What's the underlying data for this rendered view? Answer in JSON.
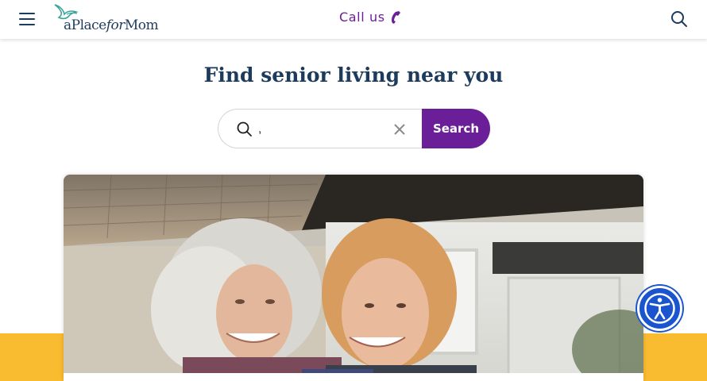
{
  "header": {
    "menu_icon": "hamburger-menu-icon",
    "logo_text_a": "a",
    "logo_text_place": "Place",
    "logo_text_for": "for",
    "logo_text_mom": "Mom",
    "call_label": "Call us",
    "call_icon": "phone-icon",
    "search_icon": "search-icon"
  },
  "main": {
    "title": "Find senior living near you",
    "search": {
      "value": ",",
      "placeholder": "",
      "button_label": "Search",
      "search_icon": "search-icon",
      "clear_icon": "close-icon"
    }
  },
  "hero": {
    "image": "two smiling senior women in front of a house"
  },
  "accessibility": {
    "icon": "accessibility-icon"
  },
  "colors": {
    "brand_navy": "#1d3b5c",
    "brand_purple": "#6a1e98",
    "band_yellow": "#f9bb30",
    "a11y_blue": "#1a55cf"
  }
}
